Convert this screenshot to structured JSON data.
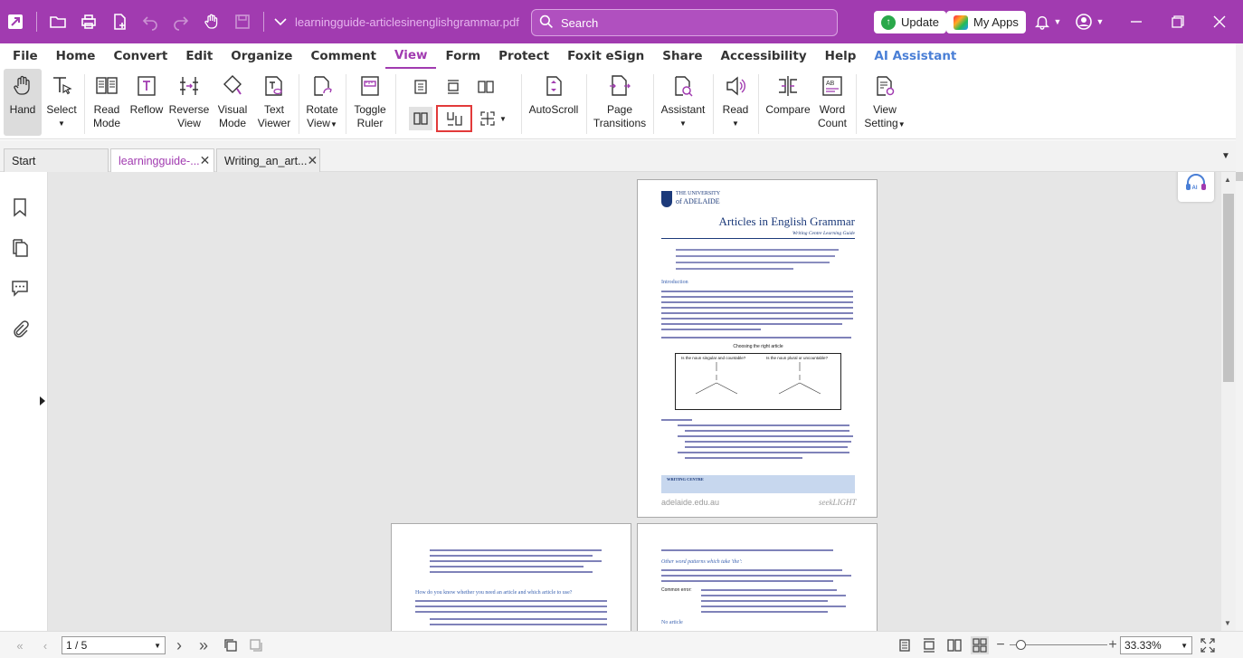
{
  "titlebar": {
    "filename": "learningguide-articlesinenglishgrammar.pdf",
    "search_placeholder": "Search",
    "update_label": "Update",
    "myapps_label": "My Apps"
  },
  "menu": [
    "File",
    "Home",
    "Convert",
    "Edit",
    "Organize",
    "Comment",
    "View",
    "Form",
    "Protect",
    "Foxit eSign",
    "Share",
    "Accessibility",
    "Help",
    "AI Assistant"
  ],
  "ribbon": {
    "hand": "Hand",
    "select": "Select",
    "read_mode_1": "Read",
    "read_mode_2": "Mode",
    "reflow": "Reflow",
    "reverse_1": "Reverse",
    "reverse_2": "View",
    "visual_1": "Visual",
    "visual_2": "Mode",
    "text_1": "Text",
    "text_2": "Viewer",
    "rotate_1": "Rotate",
    "rotate_2": "View",
    "toggle_1": "Toggle",
    "toggle_2": "Ruler",
    "autoscroll": "AutoScroll",
    "page_trans_1": "Page",
    "page_trans_2": "Transitions",
    "assistant": "Assistant",
    "read": "Read",
    "compare": "Compare",
    "word_1": "Word",
    "word_2": "Count",
    "view_setting_1": "View",
    "view_setting_2": "Setting"
  },
  "tabs": [
    {
      "label": "Start"
    },
    {
      "label": "learningguide-..."
    },
    {
      "label": "Writing_an_art..."
    }
  ],
  "document": {
    "university_line1": "THE UNIVERSITY",
    "university_line2": "of ADELAIDE",
    "title": "Articles in English Grammar",
    "subtitle": "Writing Centre Learning Guide",
    "intro_heading": "Introduction",
    "chart_heading": "Choosing the right article",
    "q1": "Is the noun singular and countable?",
    "q2": "Is the noun plural or uncountable?",
    "example_heading": "For example:",
    "footer_centre": "WRITING CENTRE",
    "footer_url": "adelaide.edu.au",
    "footer_seek": "seekLIGHT",
    "page2_heading": "How do you know whether you need an article and which article to use?",
    "page3_heading": "Other word patterns which take 'the':",
    "page3_common": "Common error:",
    "page3_noarticle": "No article"
  },
  "status": {
    "page_indicator": "1 / 5",
    "zoom": "33.33%"
  },
  "colors": {
    "brand": "#a13bb0",
    "ai_blue": "#4a7fd6",
    "highlight": "#e23a3a"
  }
}
